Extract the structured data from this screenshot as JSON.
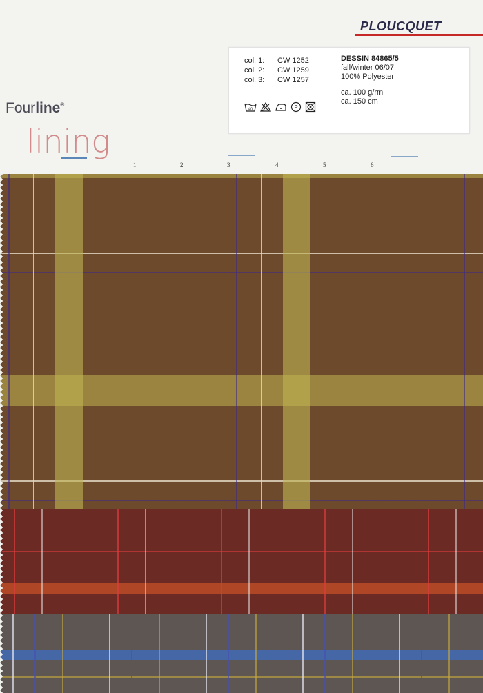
{
  "brand": "PLOUCQUET",
  "label": {
    "cols": [
      {
        "key": "col. 1:",
        "value": "CW 1252"
      },
      {
        "key": "col. 2:",
        "value": "CW 1259"
      },
      {
        "key": "col. 3:",
        "value": "CW 1257"
      }
    ],
    "dessin": "DESSIN 84865/5",
    "season": "fall/winter 06/07",
    "material": "100% Polyester",
    "weight": "ca. 100 g/rm",
    "width": "ca. 150 cm",
    "care_icons": [
      "wash-40-icon",
      "no-bleach-icon",
      "iron-low-icon",
      "dryclean-p-icon",
      "no-tumble-dry-icon"
    ],
    "wash_temp": "40"
  },
  "logo": {
    "four": "Four",
    "line": "line",
    "reg": "®",
    "lining": "lining"
  },
  "ruler": [
    "1",
    "2",
    "3",
    "4",
    "5",
    "6"
  ],
  "colors": {
    "brand_red": "#c62828",
    "swatch1": "#6e4a2c",
    "swatch2": "#6b2a24",
    "swatch3": "#5d5653"
  }
}
